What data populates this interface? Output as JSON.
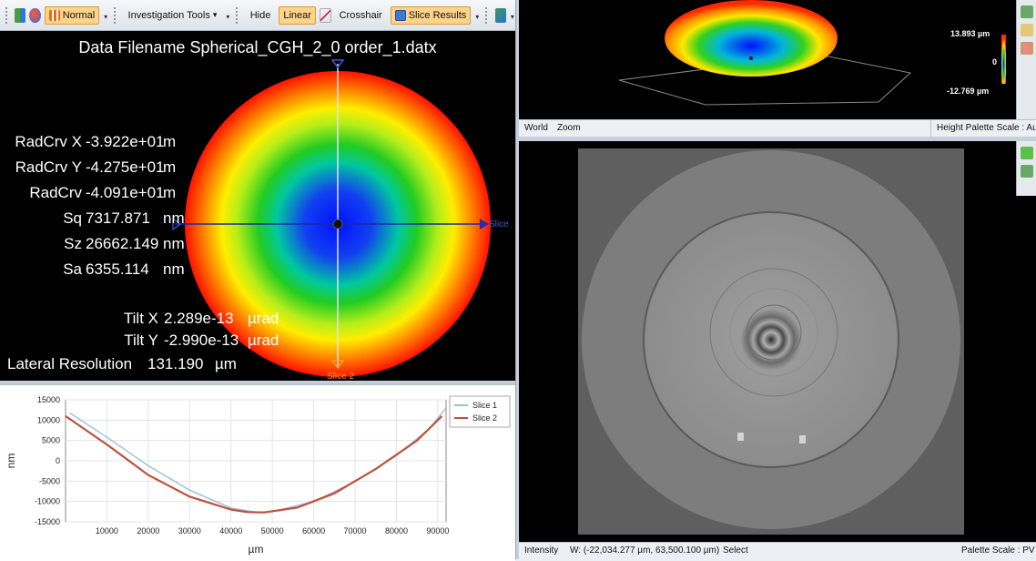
{
  "toolbar": {
    "normal_label": "Normal",
    "investigation_label": "Investigation Tools",
    "investigation_arrow": "▾",
    "hide_label": "Hide",
    "linear_label": "Linear",
    "crosshair_label": "Crosshair",
    "slice_results_label": "Slice Results"
  },
  "view2d": {
    "title": "Data Filename Spherical_CGH_2_0 order_1.datx",
    "stats": [
      {
        "label": "RadCrv X",
        "value": "-3.922e+01",
        "unit": "m"
      },
      {
        "label": "RadCrv Y",
        "value": "-4.275e+01",
        "unit": "m"
      },
      {
        "label": "RadCrv",
        "value": "-4.091e+01",
        "unit": "m"
      },
      {
        "label": "Sq",
        "value": "7317.871",
        "unit": "nm"
      },
      {
        "label": "Sz",
        "value": "26662.149",
        "unit": "nm"
      },
      {
        "label": "Sa",
        "value": "6355.114",
        "unit": "nm"
      }
    ],
    "tilts": [
      {
        "label": "Tilt X",
        "value": "2.289e-13",
        "unit": "µrad"
      },
      {
        "label": "Tilt Y",
        "value": "-2.990e-13",
        "unit": "µrad"
      }
    ],
    "lateral": {
      "label": "Lateral Resolution",
      "value": "131.190",
      "unit": "µm"
    },
    "slice1_label": "Slice",
    "slice2_label": "Slice 2"
  },
  "view3d": {
    "height_max": "13.893 µm",
    "height_zero": "0",
    "height_min": "-12.769 µm",
    "status_world": "World",
    "status_zoom": "Zoom",
    "status_palette": "Height Palette Scale : Auto"
  },
  "intensity_view": {
    "status_intensity": "Intensity",
    "status_coords": "W: (-22,034.277 µm, 63,500.100 µm)",
    "status_select": "Select",
    "status_palette": "Palette Scale : PV"
  },
  "chart_data": {
    "type": "line",
    "xlabel": "µm",
    "ylabel": "nm",
    "xlim": [
      0,
      92000
    ],
    "ylim": [
      -15000,
      15000
    ],
    "xticks": [
      10000,
      20000,
      30000,
      40000,
      50000,
      60000,
      70000,
      80000,
      90000
    ],
    "yticks": [
      15000,
      10000,
      5000,
      0,
      -5000,
      -10000,
      -15000
    ],
    "legend_position": "top-right",
    "series": [
      {
        "name": "Slice 1",
        "color": "#9bbfdf",
        "points": [
          [
            1000,
            11800
          ],
          [
            10000,
            5800
          ],
          [
            20000,
            -1200
          ],
          [
            30000,
            -7200
          ],
          [
            40000,
            -11600
          ],
          [
            46000,
            -12600
          ],
          [
            50000,
            -12500
          ],
          [
            60000,
            -10000
          ],
          [
            70000,
            -5100
          ],
          [
            80000,
            1300
          ],
          [
            88000,
            8000
          ],
          [
            92000,
            13000
          ]
        ]
      },
      {
        "name": "Slice 2",
        "color": "#c0503c",
        "points": [
          [
            0,
            11000
          ],
          [
            10000,
            4000
          ],
          [
            20000,
            -3500
          ],
          [
            30000,
            -8800
          ],
          [
            40000,
            -12000
          ],
          [
            44000,
            -12600
          ],
          [
            48000,
            -12700
          ],
          [
            56000,
            -11500
          ],
          [
            65000,
            -8000
          ],
          [
            75000,
            -2000
          ],
          [
            85000,
            5000
          ],
          [
            91000,
            11000
          ]
        ]
      }
    ]
  }
}
